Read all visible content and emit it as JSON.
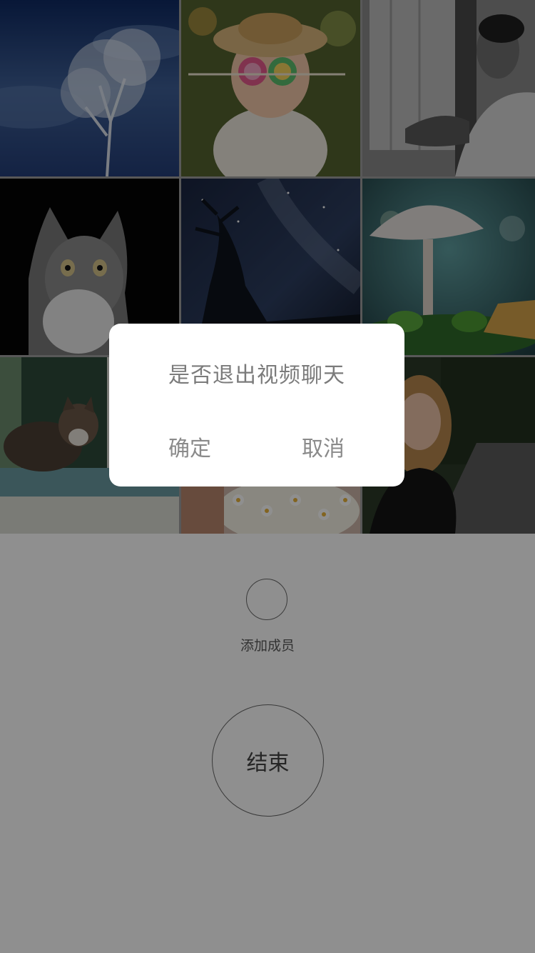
{
  "tiles": [
    {
      "name": "snowy-tree",
      "colors": {
        "bg": "#3e5f96",
        "accent": "#dfe6f1"
      }
    },
    {
      "name": "girl-with-lollipops",
      "colors": {
        "bg": "#6b7d3e",
        "accent": "#e98bb0"
      }
    },
    {
      "name": "man-by-window",
      "colors": {
        "bg": "#8f8f8f",
        "accent": "#2b2b2b"
      }
    },
    {
      "name": "tabby-cat-portrait",
      "colors": {
        "bg": "#050505",
        "accent": "#b8b8b8"
      }
    },
    {
      "name": "night-sky-tree",
      "colors": {
        "bg": "#1f2b45",
        "accent": "#0f1520"
      }
    },
    {
      "name": "mushroom",
      "colors": {
        "bg": "#3f7a7e",
        "accent": "#e8e2de"
      }
    },
    {
      "name": "cat-on-window-ledge",
      "colors": {
        "bg": "#3b5a48",
        "accent": "#6fa1a3"
      }
    },
    {
      "name": "daisy-bouquet",
      "colors": {
        "bg": "#c9a9a0",
        "accent": "#f6f3ea"
      }
    },
    {
      "name": "woman-on-road",
      "colors": {
        "bg": "#2d3a2a",
        "accent": "#c79a7a"
      }
    }
  ],
  "add_member": {
    "label": "添加成员"
  },
  "end_button": {
    "label": "结束"
  },
  "dialog": {
    "message": "是否退出视频聊天",
    "confirm_label": "确定",
    "cancel_label": "取消"
  },
  "colors": {
    "overlay": "rgba(0,0,0,0.44)",
    "dialog_bg": "#ffffff",
    "dialog_text": "#7b7b7b"
  }
}
